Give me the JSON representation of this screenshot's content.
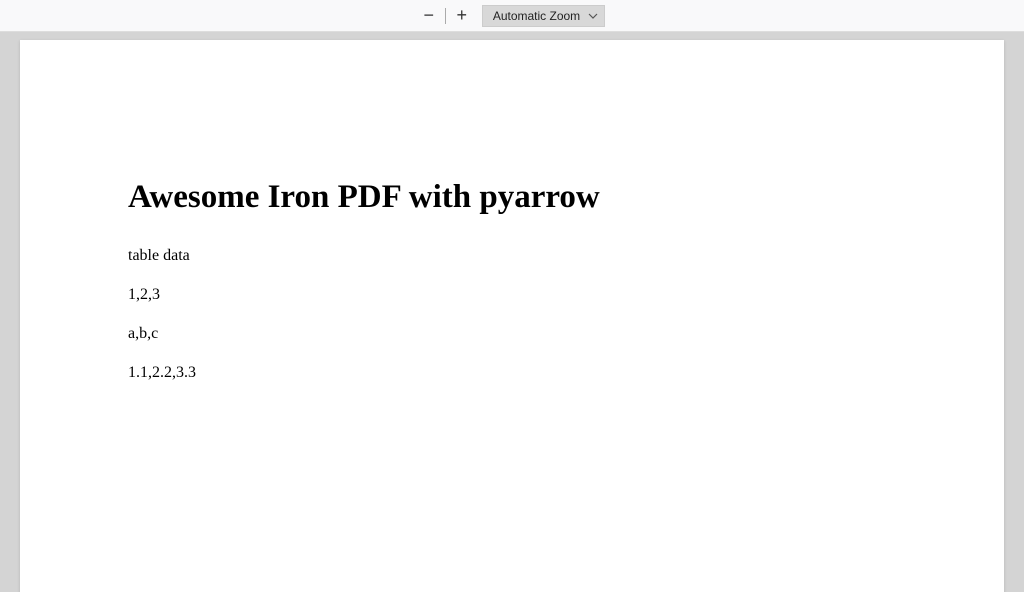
{
  "toolbar": {
    "zoom_out_symbol": "−",
    "zoom_in_symbol": "+",
    "zoom_select_label": "Automatic Zoom"
  },
  "document": {
    "title": "Awesome Iron PDF with pyarrow",
    "lines": [
      "table data",
      "1,2,3",
      "a,b,c",
      "1.1,2.2,3.3"
    ]
  }
}
